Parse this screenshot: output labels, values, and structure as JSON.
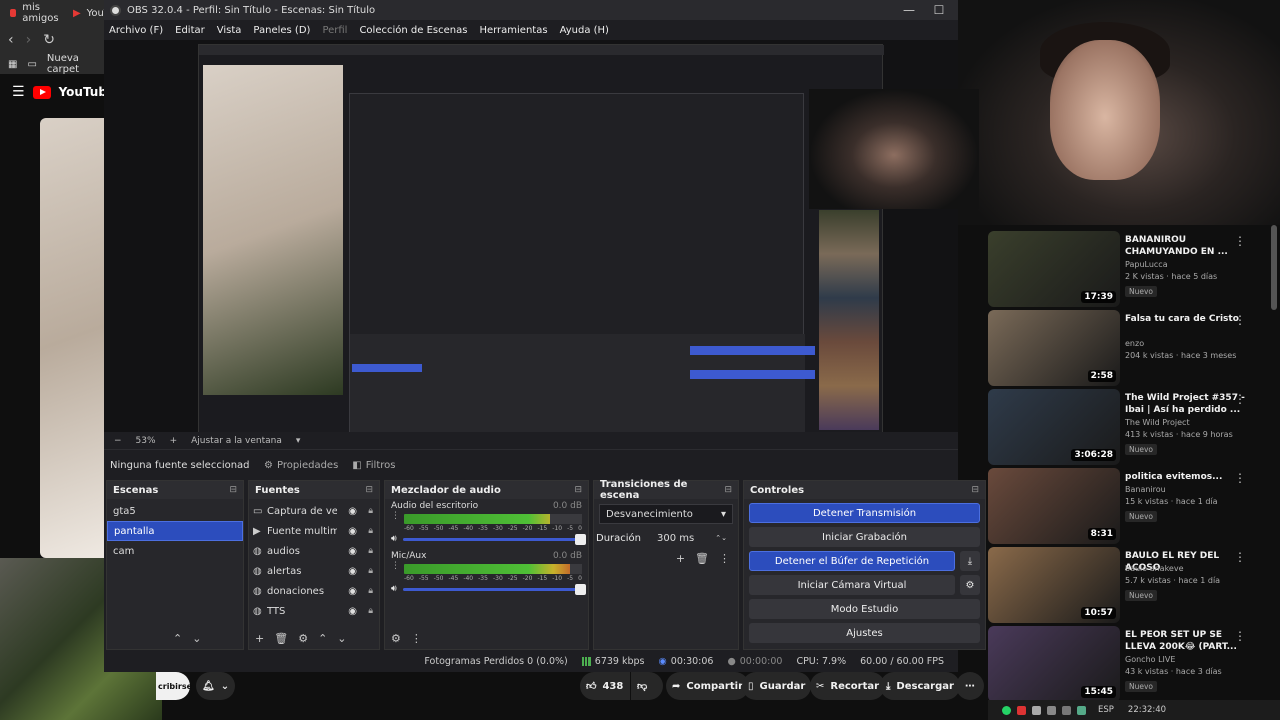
{
  "browser": {
    "tab_label": "mis amigos",
    "tab_label2": "YouT",
    "bookmark": "Nueva carpet",
    "yt_logo": "YouTube"
  },
  "obs": {
    "title": "OBS 32.0.4 - Perfil: Sin Título - Escenas: Sin Título",
    "menu": [
      "Archivo (F)",
      "Editar",
      "Vista",
      "Paneles (D)",
      "Perfil",
      "Colección de Escenas",
      "Herramientas",
      "Ayuda (H)"
    ],
    "zoom": "53%",
    "fit_label": "Ajustar a la ventana",
    "no_source": "Ninguna fuente seleccionad",
    "properties": "Propiedades",
    "filters": "Filtros",
    "docks": {
      "scenes": "Escenas",
      "sources": "Fuentes",
      "mixer": "Mezclador de audio",
      "transitions": "Transiciones de escena",
      "controls": "Controles"
    },
    "scenes": [
      "gta5",
      "pantalla",
      "cam"
    ],
    "sources": [
      "Captura de vent",
      "Fuente multime",
      "audios",
      "alertas",
      "donaciones",
      "TTS"
    ],
    "mixer": [
      {
        "name": "Audio del escritorio",
        "db": "0.0 dB",
        "level": 0.82
      },
      {
        "name": "Mic/Aux",
        "db": "0.0 dB",
        "level": 0.93
      }
    ],
    "mixer_ticks": [
      "-60",
      "-55",
      "-50",
      "-45",
      "-40",
      "-35",
      "-30",
      "-25",
      "-20",
      "-15",
      "-10",
      "-5",
      "0"
    ],
    "transition": "Desvanecimiento",
    "duration_label": "Duración",
    "duration_value": "300 ms",
    "controls": [
      "Detener Transmisión",
      "Iniciar Grabación",
      "Detener el Búfer de Repetición",
      "Iniciar Cámara Virtual",
      "Modo Estudio",
      "Ajustes"
    ],
    "status": {
      "dropped": "Fotogramas Perdidos 0 (0.0%)",
      "kbps": "6739 kbps",
      "live_time": "00:30:06",
      "rec_time": "00:00:00",
      "cpu": "CPU: 7.9%",
      "fps": "60.00 / 60.00 FPS"
    }
  },
  "videos": [
    {
      "title": "BANANIROU CHAMUYANDO EN ...",
      "channel": "PapuLucca",
      "meta": "2 K vistas · hace 5 días",
      "badge": "Nuevo",
      "duration": "17:39",
      "color": "#3a3f2c"
    },
    {
      "title": "Falsa tu cara de Cristo",
      "channel": "enzo",
      "meta": "204 k vistas · hace 3 meses",
      "badge": "",
      "duration": "2:58",
      "color": "#7a6a58"
    },
    {
      "title": "The Wild Project #357 - Ibai | Así ha perdido ...",
      "channel": "The Wild Project",
      "meta": "413 k vistas · hace 9 horas",
      "badge": "Nuevo",
      "duration": "3:06:28",
      "color": "#2f3b4a"
    },
    {
      "title": "politica evitemos...",
      "channel": "Bananirou",
      "meta": "15 k vistas · hace 1 día",
      "badge": "Nuevo",
      "duration": "8:31",
      "color": "#6a4a3c"
    },
    {
      "title": "BAULO EL REY DEL ACOSO",
      "channel": "baulo anakeve",
      "meta": "5.7 k vistas · hace 1 día",
      "badge": "Nuevo",
      "duration": "10:57",
      "color": "#8a6a4a"
    },
    {
      "title": "EL PEOR SET UP SE LLEVA 200K😂 (PART...",
      "channel": "Goncho LIVE",
      "meta": "43 k vistas · hace 3 días",
      "badge": "Nuevo",
      "duration": "15:45",
      "color": "#4a3a5a"
    }
  ],
  "ytbar": {
    "subscribe": "cribirse",
    "likes": "438",
    "share": "Compartir",
    "save": "Guardar",
    "clip": "Recortar",
    "download": "Descargar"
  },
  "taskbar": {
    "lang": "ESP",
    "time": "22:32:40"
  }
}
